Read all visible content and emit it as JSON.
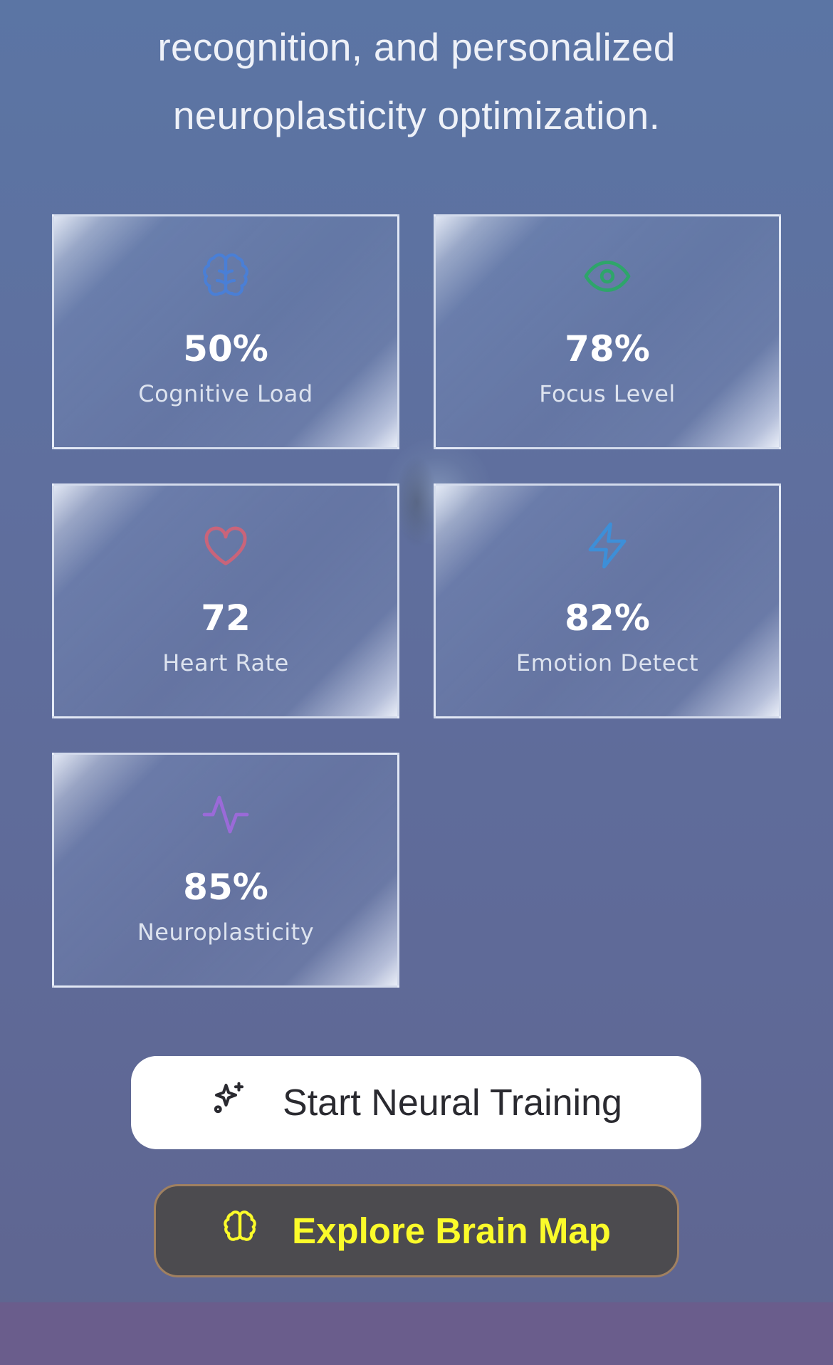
{
  "intro": {
    "line1": "recognition, and personalized",
    "line2": "neuroplasticity optimization."
  },
  "metrics": [
    {
      "value": "50%",
      "label": "Cognitive Load",
      "icon": "brain-icon",
      "color": "#4a7fd6"
    },
    {
      "value": "78%",
      "label": "Focus Level",
      "icon": "eye-icon",
      "color": "#2ea56a"
    },
    {
      "value": "72",
      "label": "Heart Rate",
      "icon": "heart-icon",
      "color": "#c9647a"
    },
    {
      "value": "82%",
      "label": "Emotion Detect",
      "icon": "lightning-icon",
      "color": "#3d8fd8"
    },
    {
      "value": "85%",
      "label": "Neuroplasticity",
      "icon": "activity-icon",
      "color": "#9a6ad8"
    }
  ],
  "actions": {
    "primary": {
      "label": "Start Neural Training",
      "icon": "sparkles-icon"
    },
    "secondary": {
      "label": "Explore Brain Map",
      "icon": "brain-icon",
      "text_color": "#fbfb2a"
    }
  }
}
